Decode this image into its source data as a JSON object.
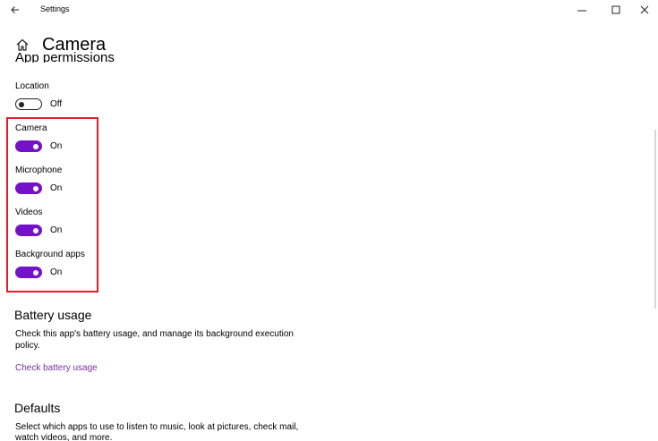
{
  "window": {
    "title": "Settings",
    "back_icon": "back-arrow-icon",
    "controls": [
      "minimize-icon",
      "maximize-icon",
      "close-icon"
    ]
  },
  "page": {
    "home_icon": "home-icon",
    "title": "Camera"
  },
  "section_partial": "App permissions",
  "permissions": [
    {
      "label": "Location",
      "state": "Off",
      "on": false
    },
    {
      "label": "Camera",
      "state": "On",
      "on": true
    },
    {
      "label": "Microphone",
      "state": "On",
      "on": true
    },
    {
      "label": "Videos",
      "state": "On",
      "on": true
    },
    {
      "label": "Background apps",
      "state": "On",
      "on": true
    }
  ],
  "battery": {
    "heading": "Battery usage",
    "description": "Check this app's battery usage, and manage its background execution policy.",
    "link": "Check battery usage"
  },
  "defaults": {
    "heading": "Defaults",
    "description_line1": "Select which apps to use to listen to music, look at pictures, check mail,",
    "description_line2": "watch videos, and more."
  },
  "colors": {
    "toggle_on": "#7312c8",
    "highlight": "#e21d2a",
    "link": "#7a2ea6"
  }
}
